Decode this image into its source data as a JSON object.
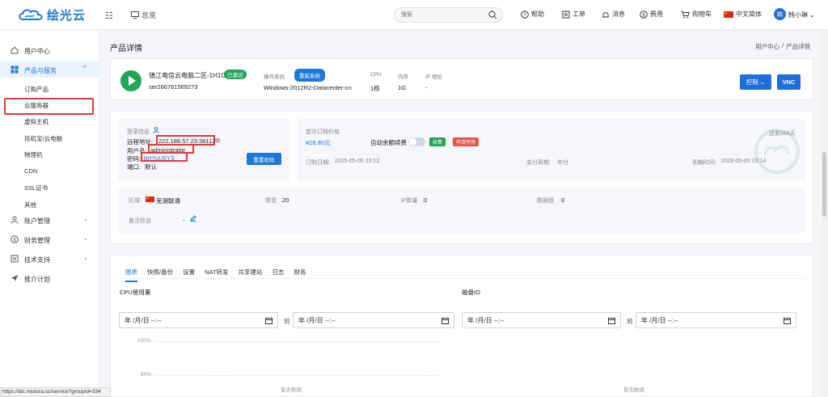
{
  "header": {
    "logo_text": "绘光云",
    "overview_label": "总览",
    "search_placeholder": "搜索",
    "nav": [
      "帮助",
      "工单",
      "消息",
      "费用",
      "购物车",
      "中文简体"
    ],
    "username": "韩小琳",
    "avatar_text": "韩",
    "brand_color": "#1e78d7"
  },
  "sidebar": {
    "items": [
      {
        "label": "用户中心",
        "icon": "home-icon"
      },
      {
        "label": "产品与服务",
        "icon": "grid-icon"
      },
      {
        "label": "账户管理",
        "icon": "user-icon"
      },
      {
        "label": "财务管理",
        "icon": "money-icon"
      },
      {
        "label": "技术支持",
        "icon": "doc-icon"
      },
      {
        "label": "推介计划",
        "icon": "send-icon"
      }
    ],
    "sub_items": [
      "订购产品",
      "云服务器",
      "虚拟主机",
      "挂机宝/云电脑",
      "物理机",
      "CDN",
      "SSL证书",
      "其他"
    ]
  },
  "page": {
    "title": "产品详情",
    "breadcrumb": [
      "用户中心",
      "/",
      "产品详情"
    ]
  },
  "product": {
    "name": "镇江电信云电脑二区-1H1G",
    "status": "已激活",
    "id": "ser266761569273",
    "os_label": "操作系统",
    "os_button": "重装系统",
    "os_value": "Windows-2012R2-Datacenter-cn",
    "cpu_label": "CPU",
    "cpu_value": "1核",
    "mem_label": "内存",
    "mem_value": "1G",
    "ip_label": "IP 地址",
    "ip_value": "-",
    "control_button": "控制",
    "vnc_button": "VNC"
  },
  "login": {
    "title": "登录信息",
    "remote_label": "远程地址:",
    "remote_value": "222.186.57.23:38112",
    "user_label": "用户名:",
    "user_value": "administrator",
    "pass_label": "密码:",
    "pass_value": "bHYuU6YS",
    "port_label": "端口:",
    "port_value": "默认",
    "reset_button": "重置密码"
  },
  "billing": {
    "price_label": "首次订购价格",
    "price_value": "¥28.80元",
    "auto_renew_label": "自动余额续费",
    "renew_tag": "续费",
    "refund_tag": "申请停用",
    "remaining": "还剩364天",
    "order_date_label": "订购日期:",
    "order_date": "2025-05-05 23:12",
    "cycle_label": "支付周期:",
    "cycle_value": "年付",
    "expire_label": "到期时间:",
    "expire_value": "2026-05-05 23:14"
  },
  "extra": {
    "region_label": "区域",
    "region_value": "芜湖联通",
    "bandwidth_label": "带宽",
    "bandwidth_value": "20",
    "ipcount_label": "IP数量",
    "ipcount_value": "0",
    "disk_label": "数据盘",
    "disk_value": "0",
    "remark_label": "备注信息",
    "remark_value": "-"
  },
  "tabs": [
    "图表",
    "快照/备份",
    "设置",
    "NAT转发",
    "共享建站",
    "日志",
    "财务"
  ],
  "charts": {
    "cpu_title": "CPU使用量",
    "disk_title": "磁盘IO",
    "date_placeholder": "年 /月/日 --:--",
    "to_label": "到",
    "y_ticks": [
      "100%",
      "80%"
    ],
    "no_data": "暂无数据"
  },
  "statusbar": {
    "url": "https://idc.mistora.cc/service?groupid=334"
  }
}
